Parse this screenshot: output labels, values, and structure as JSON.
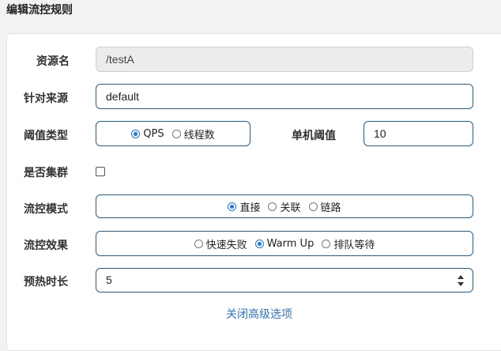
{
  "dialog": {
    "title": "编辑流控规则"
  },
  "form": {
    "resource": {
      "label": "资源名",
      "value": "/testA"
    },
    "limit_app": {
      "label": "针对来源",
      "value": "default"
    },
    "grade": {
      "label": "阈值类型",
      "options": [
        "QPS",
        "线程数"
      ],
      "selected": "QPS"
    },
    "threshold": {
      "label": "单机阈值",
      "value": "10"
    },
    "cluster": {
      "label": "是否集群",
      "checked": false
    },
    "strategy": {
      "label": "流控模式",
      "options": [
        "直接",
        "关联",
        "链路"
      ],
      "selected": "直接"
    },
    "control_behavior": {
      "label": "流控效果",
      "options": [
        "快速失败",
        "Warm Up",
        "排队等待"
      ],
      "selected": "Warm Up"
    },
    "warmup_period": {
      "label": "预热时长",
      "value": "5"
    },
    "advanced_toggle": {
      "label": "关闭高级选项"
    }
  },
  "colors": {
    "accent": "#1a73e8",
    "border": "#1f5fa8",
    "link": "#2e75c6"
  }
}
